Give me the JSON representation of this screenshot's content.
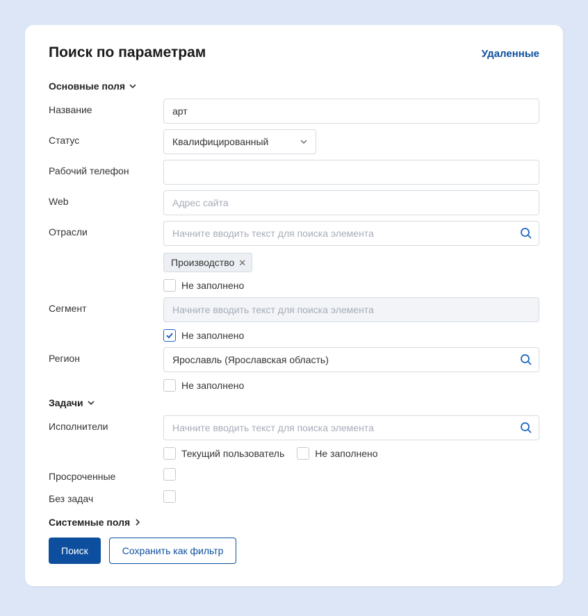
{
  "header": {
    "title": "Поиск по параметрам",
    "deleted_link": "Удаленные"
  },
  "sections": {
    "main": "Основные поля",
    "tasks": "Задачи",
    "system": "Системные поля"
  },
  "labels": {
    "name": "Название",
    "status": "Статус",
    "work_phone": "Рабочий телефон",
    "web": "Web",
    "industries": "Отрасли",
    "segment": "Сегмент",
    "region": "Регион",
    "executors": "Исполнители",
    "overdue": "Просроченные",
    "no_tasks": "Без задач"
  },
  "values": {
    "name": "арт",
    "status": "Квалифицированный",
    "work_phone": "",
    "web": "",
    "region": "Ярославль (Ярославская область)"
  },
  "placeholders": {
    "web": "Адрес сайта",
    "lookup": "Начните вводить текст для поиска элемента"
  },
  "tags": {
    "industry": "Производство"
  },
  "checkboxes": {
    "not_filled": "Не заполнено",
    "current_user": "Текущий пользователь"
  },
  "buttons": {
    "search": "Поиск",
    "save_filter": "Сохранить как фильтр"
  }
}
